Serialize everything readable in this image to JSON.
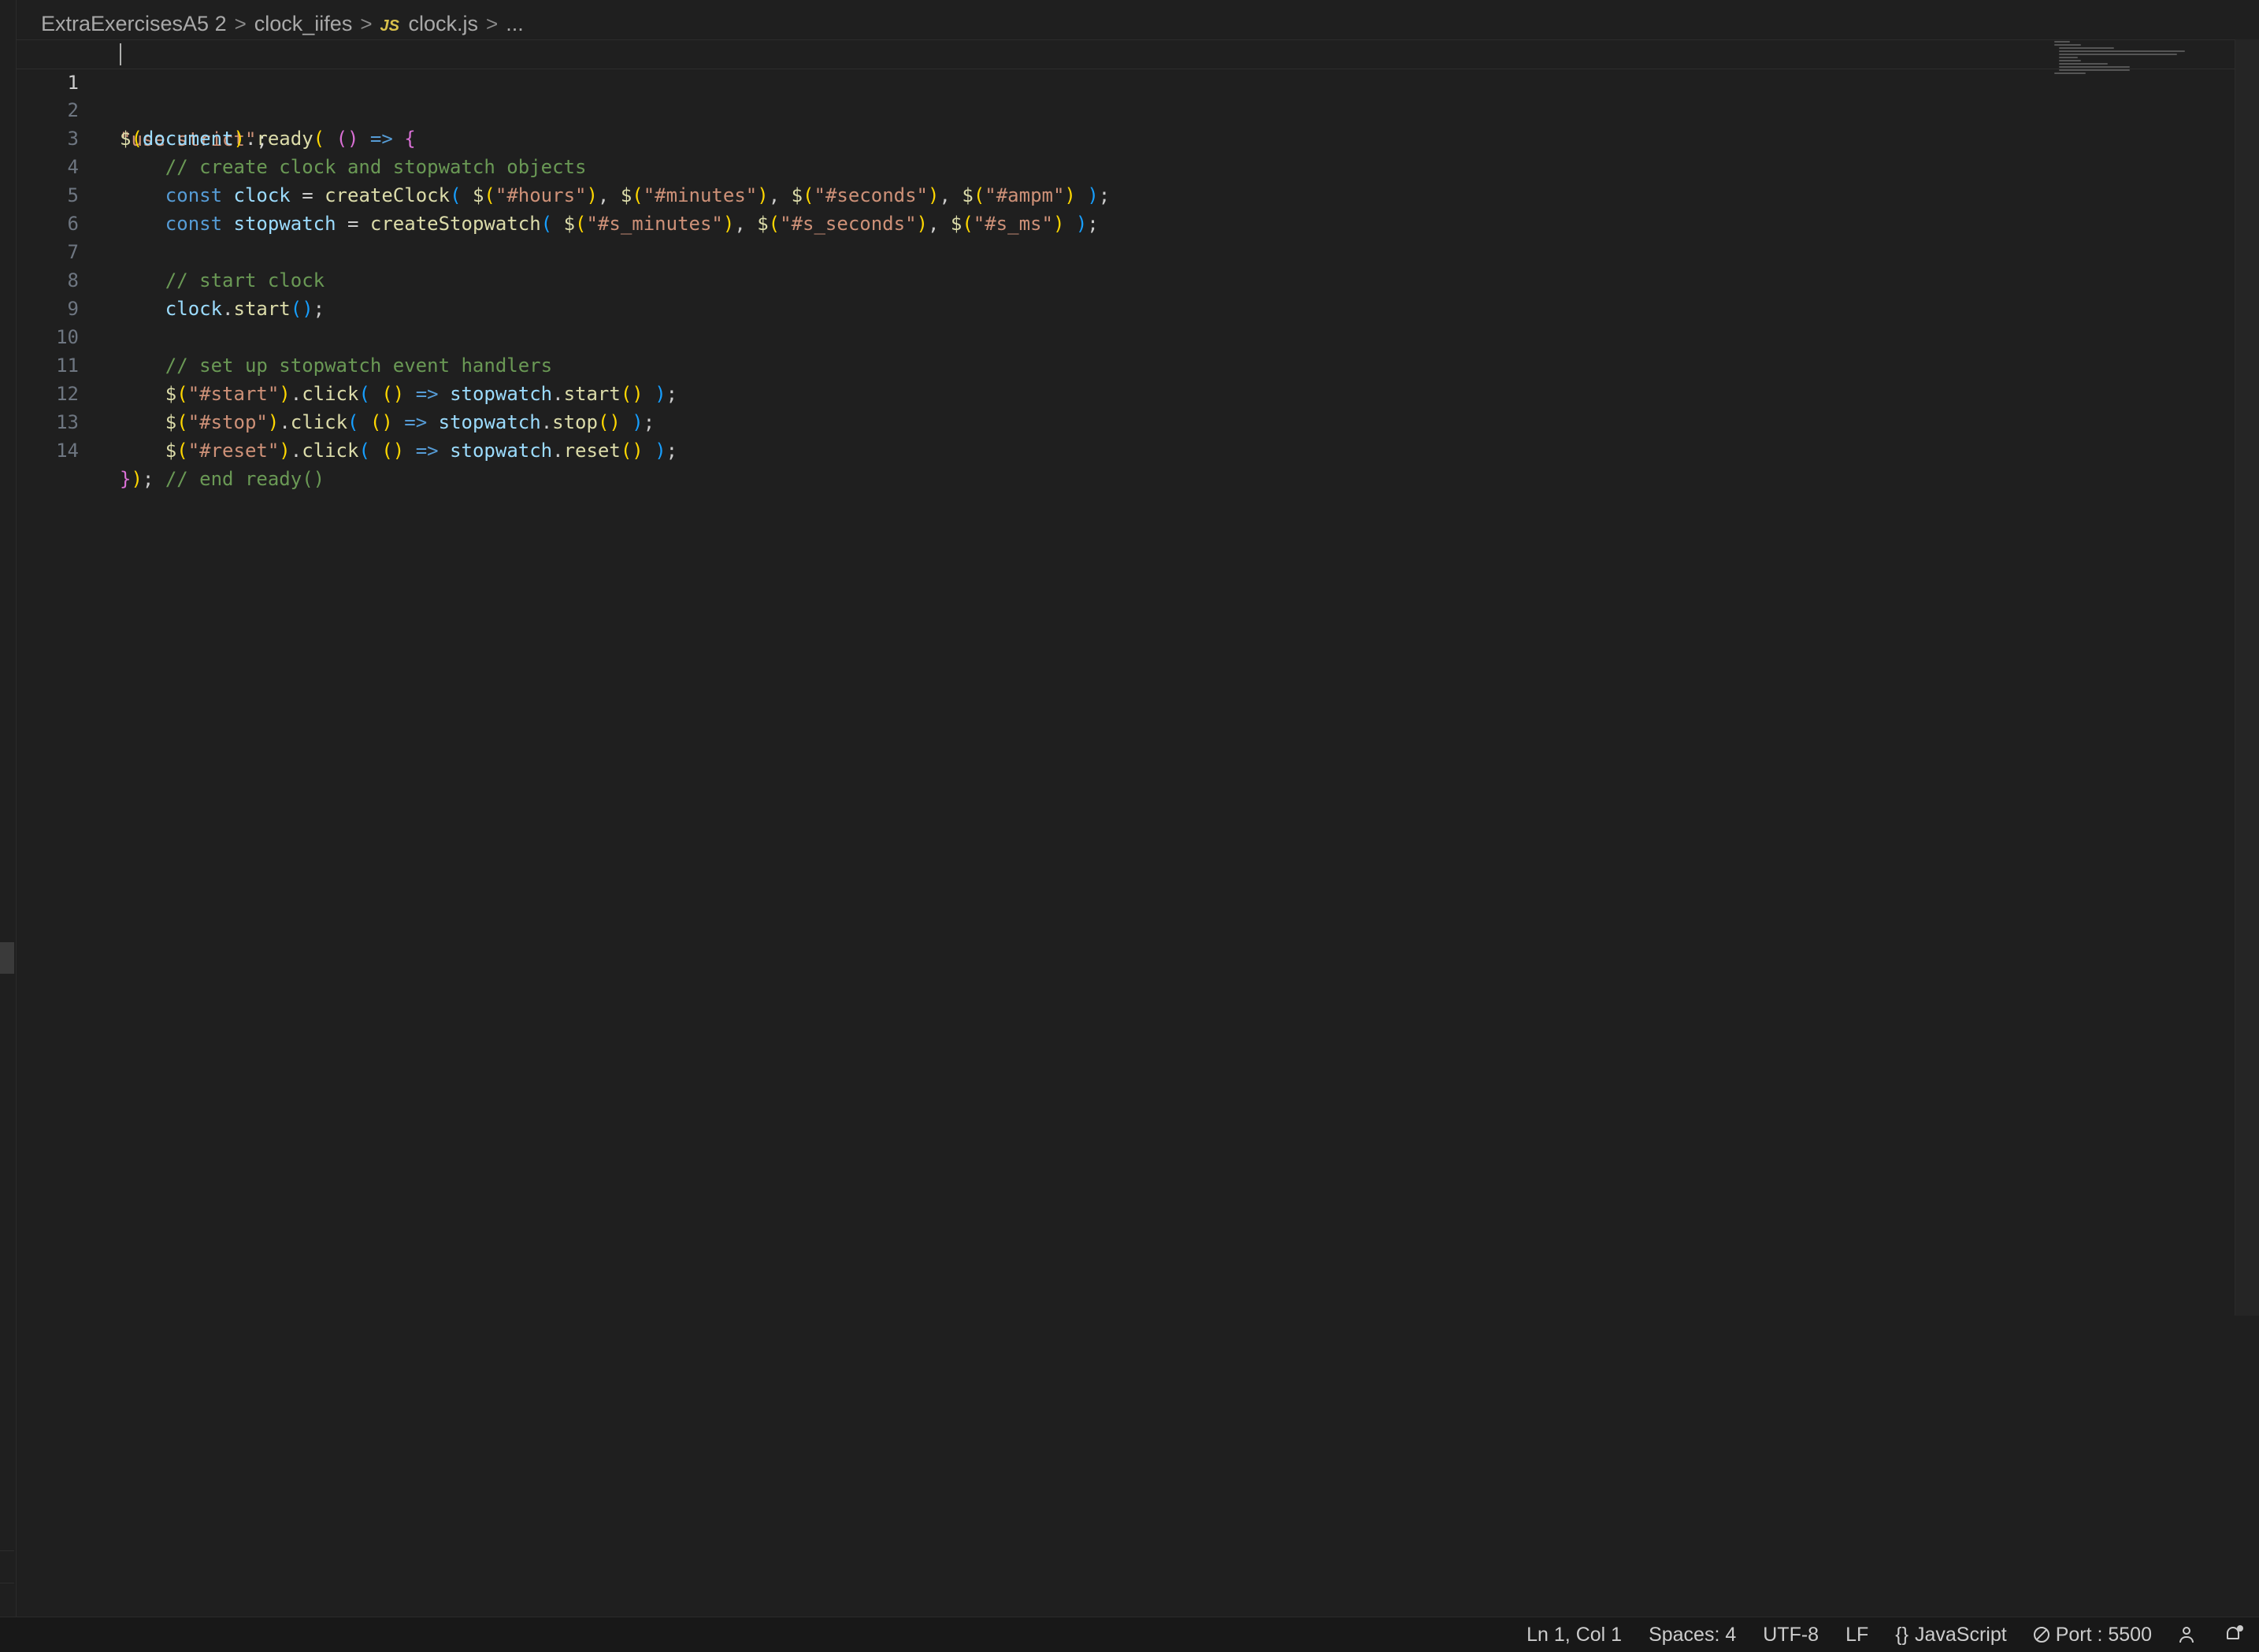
{
  "breadcrumb": {
    "folder": "ExtraExercisesA5 2",
    "subfolder": "clock_iifes",
    "file_icon": "JS",
    "file": "clock.js",
    "more": "...",
    "separator": ">"
  },
  "editor": {
    "active_line": 1,
    "lines": [
      {
        "n": "1"
      },
      {
        "n": "2"
      },
      {
        "n": "3"
      },
      {
        "n": "4"
      },
      {
        "n": "5"
      },
      {
        "n": "6"
      },
      {
        "n": "7"
      },
      {
        "n": "8"
      },
      {
        "n": "9"
      },
      {
        "n": "10"
      },
      {
        "n": "11"
      },
      {
        "n": "12"
      },
      {
        "n": "13"
      },
      {
        "n": "14"
      }
    ],
    "tokens": {
      "l1_str": "\"use strict\"",
      "l1_semi": ";",
      "l2_doc": "document",
      "l2_ready": "ready",
      "l3_comment": "// create clock and stopwatch objects",
      "const": "const",
      "l4_var": "clock",
      "l4_fn": "createClock",
      "l4_s1": "\"#hours\"",
      "l4_s2": "\"#minutes\"",
      "l4_s3": "\"#seconds\"",
      "l4_s4": "\"#ampm\"",
      "l5_var": "stopwatch",
      "l5_fn": "createStopwatch",
      "l5_s1": "\"#s_minutes\"",
      "l5_s2": "\"#s_seconds\"",
      "l5_s3": "\"#s_ms\"",
      "l7_comment": "// start clock",
      "l8_var": "clock",
      "l8_fn": "start",
      "l10_comment": "// set up stopwatch event handlers",
      "l11_s": "\"#start\"",
      "l12_s": "\"#stop\"",
      "l13_s": "\"#reset\"",
      "click": "click",
      "sw": "stopwatch",
      "start": "start",
      "stop": "stop",
      "reset": "reset",
      "l14_comment": "// end ready()"
    }
  },
  "statusbar": {
    "position": "Ln 1, Col 1",
    "spaces": "Spaces: 4",
    "encoding": "UTF-8",
    "eol": "LF",
    "language_icon": "{}",
    "language": "JavaScript",
    "port": "Port : 5500"
  },
  "colors": {
    "string": "#ce9178",
    "keyword": "#569cd6",
    "function": "#dcdcaa",
    "variable": "#9cdcfe",
    "comment": "#6a9955",
    "background": "#1f1f1f"
  }
}
